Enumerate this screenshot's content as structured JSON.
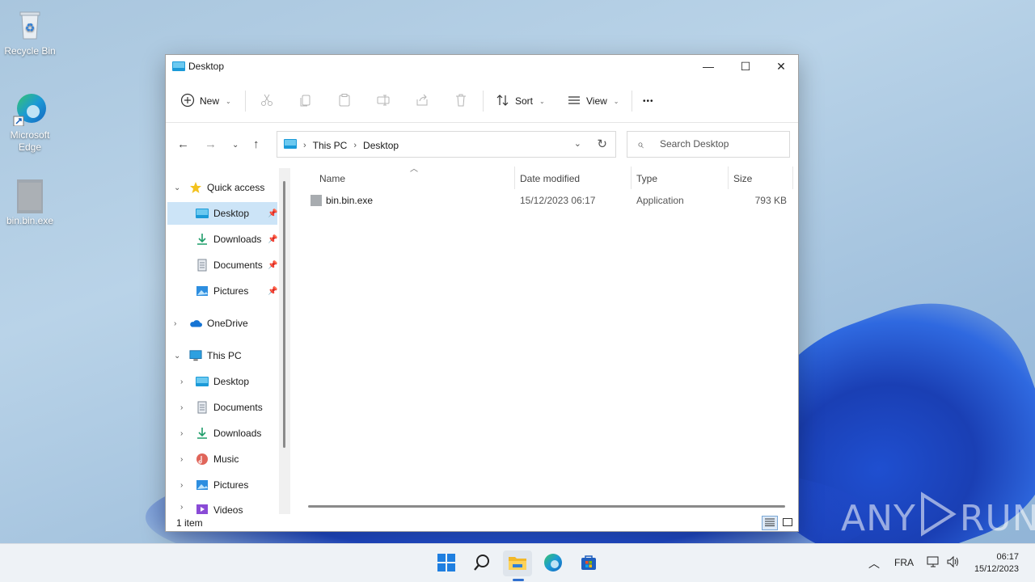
{
  "desktop": {
    "icons": [
      {
        "label": "Recycle Bin",
        "icon": "recycle-bin-icon"
      },
      {
        "label": "Microsoft Edge",
        "icon": "edge-icon"
      },
      {
        "label": "bin.bin.exe",
        "icon": "exe-file-icon"
      }
    ]
  },
  "window": {
    "title": "Desktop",
    "controls": {
      "minimize": "—",
      "maximize": "☐",
      "close": "✕"
    }
  },
  "toolbar": {
    "new_label": "New",
    "sort_label": "Sort",
    "view_label": "View",
    "more_label": "•••",
    "icons": [
      "cut-icon",
      "copy-icon",
      "paste-icon",
      "rename-icon",
      "share-icon",
      "delete-icon"
    ]
  },
  "address": {
    "crumbs": [
      "This PC",
      "Desktop"
    ]
  },
  "search": {
    "placeholder": "Search Desktop"
  },
  "navpane": {
    "quick_access": "Quick access",
    "qa_items": [
      "Desktop",
      "Downloads",
      "Documents",
      "Pictures"
    ],
    "onedrive": "OneDrive",
    "this_pc": "This PC",
    "pc_items": [
      "Desktop",
      "Documents",
      "Downloads",
      "Music",
      "Pictures",
      "Videos"
    ]
  },
  "columns": {
    "name": "Name",
    "date": "Date modified",
    "type": "Type",
    "size": "Size"
  },
  "files": [
    {
      "name": "bin.bin.exe",
      "date": "15/12/2023 06:17",
      "type": "Application",
      "size": "793 KB"
    }
  ],
  "status": {
    "count": "1 item"
  },
  "taskbar": {
    "lang": "FRA",
    "time": "06:17",
    "date": "15/12/2023"
  },
  "watermark": {
    "text_left": "ANY",
    "text_right": "RUN"
  },
  "colors": {
    "accent": "#2f6fcf",
    "selection": "#cce4f7"
  }
}
